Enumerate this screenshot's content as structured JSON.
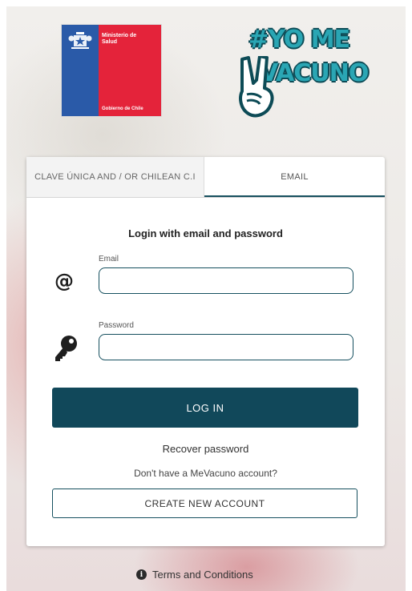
{
  "logos": {
    "ministry_line1": "Ministerio de",
    "ministry_line2": "Salud",
    "government": "Gobierno de Chile",
    "campaign_line1": "#YO ME",
    "campaign_line2": "VACUNO"
  },
  "tabs": [
    {
      "label": "CLAVE ÚNICA AND / OR CHILEAN C.I",
      "active": false
    },
    {
      "label": "EMAIL",
      "active": true
    }
  ],
  "form": {
    "heading": "Login with email and password",
    "email_label": "Email",
    "email_value": "",
    "password_label": "Password",
    "password_value": "",
    "login_button": "LOG IN",
    "recover_link": "Recover password",
    "no_account_text": "Don't have a MeVacuno account?",
    "create_button": "CREATE NEW ACCOUNT"
  },
  "footer": {
    "terms_link": "Terms and Conditions"
  },
  "colors": {
    "accent": "#11485a",
    "flag_blue": "#2a5aa8",
    "flag_red": "#e4233a",
    "campaign_teal": "#2aa6b4"
  },
  "icons": [
    "at-icon",
    "key-icon",
    "info-icon",
    "chile-crest-icon",
    "peace-hand-icon"
  ]
}
